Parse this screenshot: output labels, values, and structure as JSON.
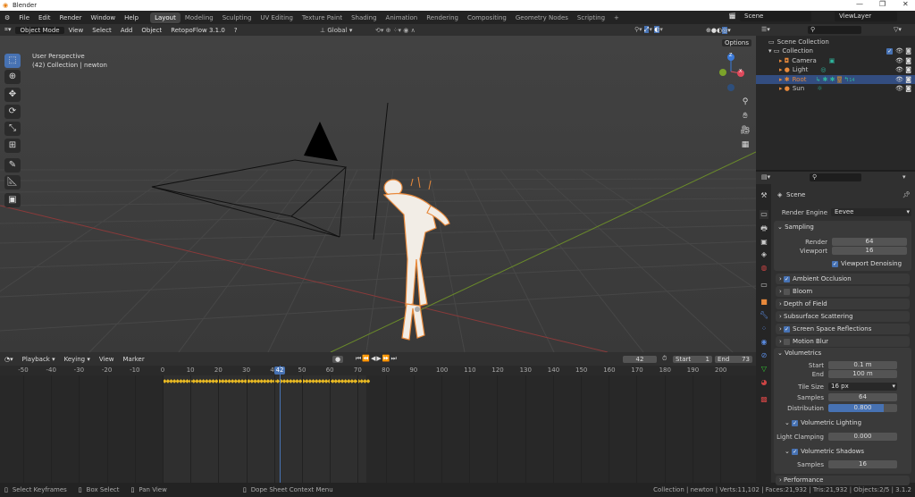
{
  "window": {
    "title": "Blender",
    "controls": [
      "—",
      "❐",
      "✕"
    ]
  },
  "menu": {
    "items": [
      "File",
      "Edit",
      "Render",
      "Window",
      "Help"
    ],
    "workspaces": [
      "Layout",
      "Modeling",
      "Sculpting",
      "UV Editing",
      "Texture Paint",
      "Shading",
      "Animation",
      "Rendering",
      "Compositing",
      "Geometry Nodes",
      "Scripting",
      "+"
    ],
    "active_workspace": "Layout",
    "scene": "Scene",
    "view_layer": "ViewLayer"
  },
  "viewport_header": {
    "mode": "Object Mode",
    "menus": [
      "View",
      "Select",
      "Add",
      "Object"
    ],
    "addon": "RetopoFlow 3.1.0",
    "orientation": "Global",
    "options": "Options"
  },
  "viewport": {
    "view_name": "User Perspective",
    "collection_info": "(42) Collection | newton",
    "gizmo_axes": {
      "z": "Z",
      "x": "X"
    }
  },
  "outliner": {
    "root": "Scene Collection",
    "collection": "Collection",
    "items": [
      {
        "name": "Camera",
        "selected": false
      },
      {
        "name": "Light",
        "selected": false
      },
      {
        "name": "Root",
        "selected": true
      },
      {
        "name": "Sun",
        "selected": false
      }
    ],
    "root_extra": "14"
  },
  "properties": {
    "context": "Scene",
    "render_engine_label": "Render Engine",
    "render_engine": "Eevee",
    "sampling": {
      "title": "Sampling",
      "render_label": "Render",
      "render": "64",
      "viewport_label": "Viewport",
      "viewport": "16",
      "denoise": "Viewport Denoising"
    },
    "panels": [
      {
        "label": "Ambient Occlusion",
        "checkbox": true,
        "checked": true
      },
      {
        "label": "Bloom",
        "checkbox": true,
        "checked": false
      },
      {
        "label": "Depth of Field",
        "checkbox": false
      },
      {
        "label": "Subsurface Scattering",
        "checkbox": false
      },
      {
        "label": "Screen Space Reflections",
        "checkbox": true,
        "checked": true
      },
      {
        "label": "Motion Blur",
        "checkbox": true,
        "checked": false
      }
    ],
    "volumetrics": {
      "title": "Volumetrics",
      "start_label": "Start",
      "start": "0.1 m",
      "end_label": "End",
      "end": "100 m",
      "tile_label": "Tile Size",
      "tile": "16 px",
      "samples_label": "Samples",
      "samples": "64",
      "distribution_label": "Distribution",
      "distribution": "0.800",
      "distribution_fraction": 0.8,
      "lighting": "Volumetric Lighting",
      "clamp_label": "Light Clamping",
      "clamp": "0.000",
      "shadows": "Volumetric Shadows",
      "shadow_samples_label": "Samples",
      "shadow_samples": "16"
    },
    "performance": "Performance"
  },
  "timeline": {
    "menus": [
      "Playback",
      "Keying",
      "View",
      "Marker"
    ],
    "current_frame": "42",
    "start_label": "Start",
    "start": "1",
    "end_label": "End",
    "end": "73",
    "ticks": [
      "-50",
      "-40",
      "-30",
      "-20",
      "-10",
      "0",
      "10",
      "20",
      "30",
      "40",
      "50",
      "60",
      "70",
      "80",
      "90",
      "100",
      "110",
      "120",
      "130",
      "140",
      "150",
      "160",
      "170",
      "180",
      "190",
      "200"
    ],
    "key_first": 0,
    "key_last": 73
  },
  "status": {
    "hints": [
      "Select Keyframes",
      "Box Select",
      "Pan View",
      "Dope Sheet Context Menu"
    ],
    "info": "Collection | newton | Verts:11,102 | Faces:21,932 | Tris:21,932 | Objects:2/5 | 3.1.2"
  },
  "colors": {
    "accent": "#4772b3",
    "selected_text": "#e8893b",
    "keyframe": "#e8b923"
  }
}
